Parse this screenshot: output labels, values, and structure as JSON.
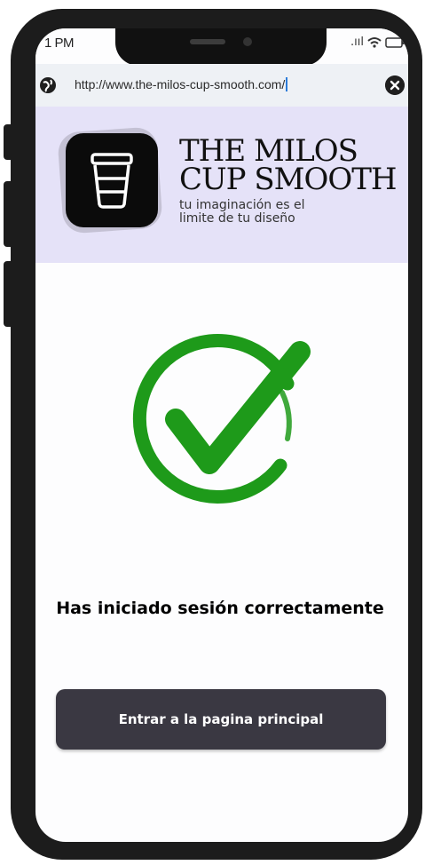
{
  "status_bar": {
    "time": "1 PM",
    "signal": ".ııl",
    "wifi": "wifi-icon",
    "battery": "battery-icon"
  },
  "browser": {
    "url": "http://www.the-milos-cup-smooth.com/",
    "globe_icon": "globe-icon",
    "close_icon": "close-icon"
  },
  "brand": {
    "title_line1": "THE MILOS",
    "title_line2": "CUP SMOOTH",
    "tagline": "tu imaginación es el limite de tu diseño",
    "logo_icon": "cup-icon"
  },
  "main": {
    "check_icon": "check-icon",
    "check_color": "#1e9a1a",
    "message": "Has iniciado sesión correctamente",
    "button_label": "Entrar a la pagina principal"
  }
}
